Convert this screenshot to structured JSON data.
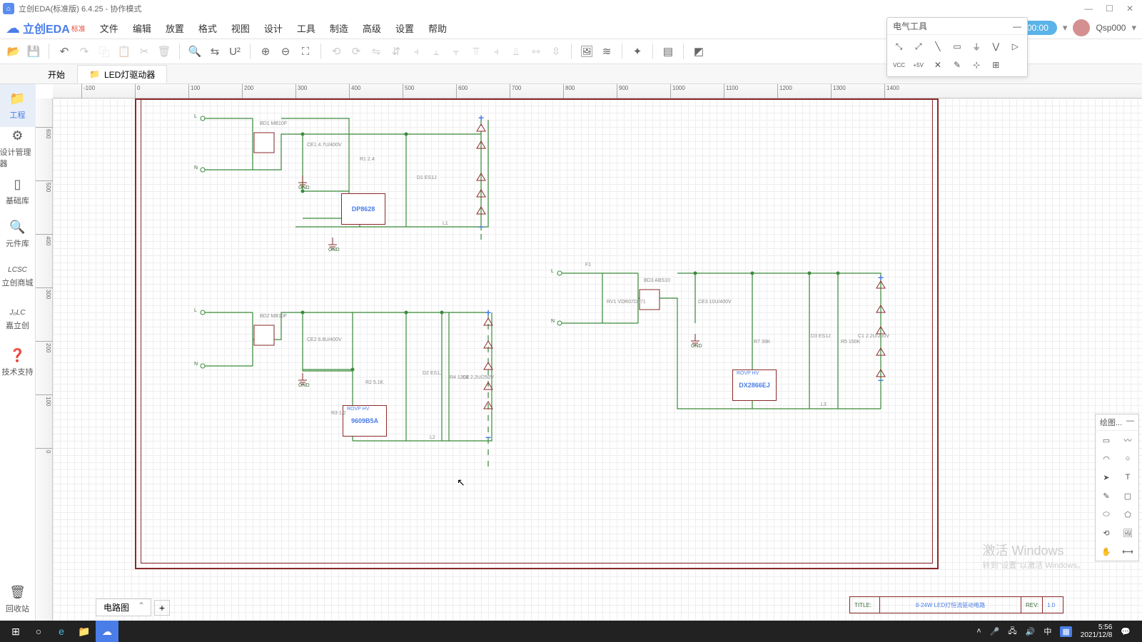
{
  "titlebar": {
    "text": "立创EDA(标准版) 6.4.25 - 协作模式"
  },
  "menu": {
    "brand": "立创EDA",
    "brand_sub": "标准",
    "items": [
      "文件",
      "编辑",
      "放置",
      "格式",
      "视图",
      "设计",
      "工具",
      "制造",
      "高级",
      "设置",
      "帮助"
    ],
    "timer": "00:00",
    "user": "Qsp000"
  },
  "tabs": {
    "start": "开始",
    "t1": "LED灯驱动器"
  },
  "sidebar": {
    "project": "工程",
    "design_mgr": "设计管理器",
    "basic_lib": "基础库",
    "elem_lib": "元件库",
    "lcsc": "立创商城",
    "jlc": "嘉立创",
    "support": "技术支持",
    "recycle": "回收站"
  },
  "toolpanel": {
    "title": "电气工具"
  },
  "drawtools": {
    "title": "绘图..."
  },
  "schematic": {
    "chips": {
      "c1": "DP8628",
      "c2": "9609B5A",
      "c3": "DX2866EJ"
    },
    "bridges": {
      "b1": "BD1\nMB10F",
      "b2": "BD2\nMB10F",
      "b3": "BD3\nABS10"
    },
    "caps": {
      "ce1": "CE1\n4.7U/400V",
      "ce2": "CE2\n6.8U/400V",
      "ce3": "CE3\n10U/400V",
      "c2": "C2\n2.2U/250V",
      "c1": "C1\n2.2U/250V"
    },
    "res": {
      "r1": "R1\n2.4",
      "r2": "R2\n5.1K",
      "r3": "R3\n1.2",
      "r4": "R4\n120K",
      "r5": "R5\n150K",
      "r7": "R7\n39K"
    },
    "diodes": {
      "d1": "D1\nES1J",
      "d2": "D2\nES1J",
      "d3": "D3\nES1J"
    },
    "ind": {
      "l1": "L1",
      "l2": "L2",
      "l3": "L3"
    },
    "fuse": "F1",
    "varistor": "RV1\nVDR07D471",
    "gnd": "GND",
    "net": {
      "L": "L",
      "N": "N"
    },
    "pinrow": "ROVP    HV"
  },
  "titleblock": {
    "title_lbl": "TITLE:",
    "title_val": "8-24W LED灯恒流驱动电路",
    "rev_lbl": "REV:",
    "rev_val": "1.0"
  },
  "sheet": {
    "name": "电路图"
  },
  "watermark": {
    "l1": "激活 Windows",
    "l2": "转到\"设置\"以激活 Windows。"
  },
  "taskbar": {
    "time": "5:56",
    "date": "2021/12/8",
    "ime": "中"
  },
  "ruler_h": [
    "-100",
    "0",
    "100",
    "200",
    "300",
    "400",
    "500",
    "600",
    "700",
    "800",
    "900",
    "1000",
    "1100",
    "1200",
    "1300",
    "1400"
  ],
  "ruler_v": [
    "600",
    "500",
    "400",
    "300",
    "200",
    "100",
    "0"
  ]
}
